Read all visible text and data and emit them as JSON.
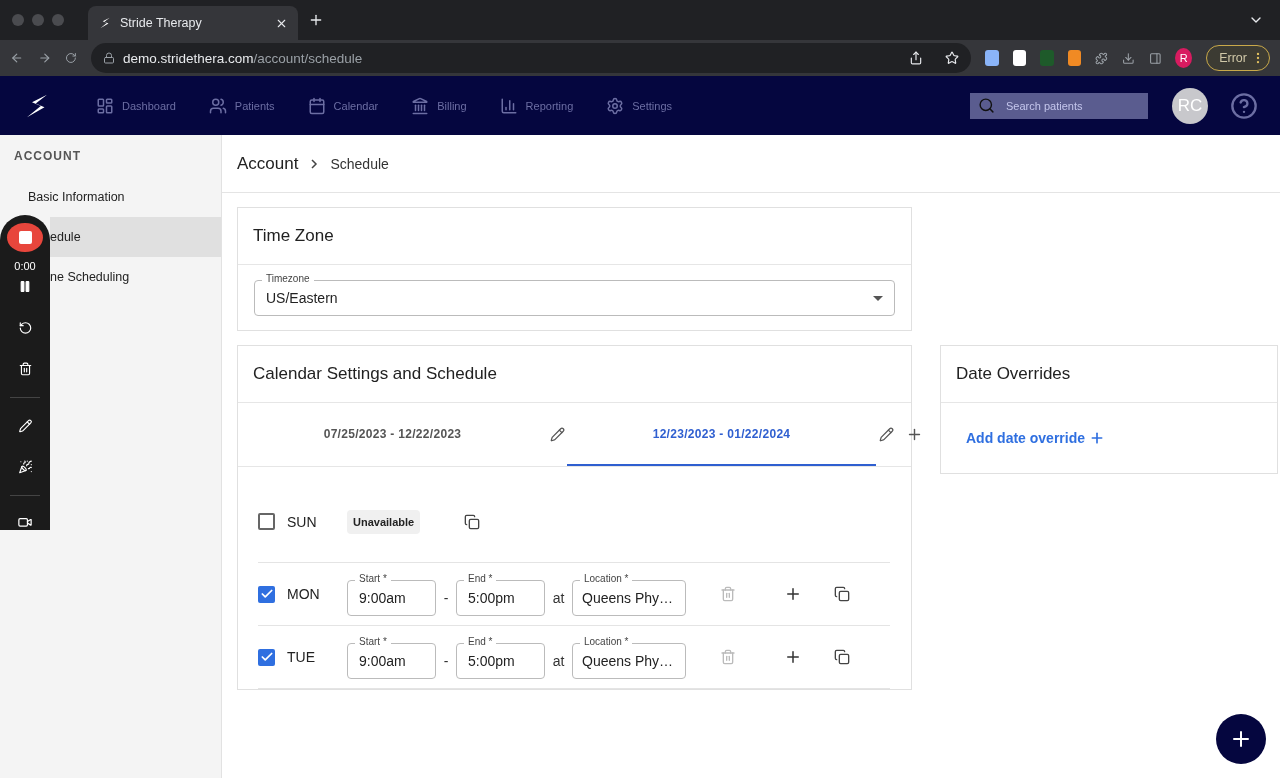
{
  "browser": {
    "tab_title": "Stride Therapy",
    "url_host": "demo.stridethera.com",
    "url_path": "/account/schedule",
    "profile_initial": "R",
    "error_label": "Error"
  },
  "nav": {
    "items": [
      {
        "label": "Dashboard"
      },
      {
        "label": "Patients"
      },
      {
        "label": "Calendar"
      },
      {
        "label": "Billing"
      },
      {
        "label": "Reporting"
      },
      {
        "label": "Settings"
      }
    ],
    "search_placeholder": "Search patients",
    "avatar": "RC"
  },
  "sidebar": {
    "heading": "ACCOUNT",
    "items": [
      {
        "label": "Basic Information",
        "selected": false
      },
      {
        "label": "edule",
        "selected": true
      },
      {
        "label": "ne Scheduling",
        "selected": false
      }
    ]
  },
  "recorder": {
    "time": "0:00"
  },
  "breadcrumb": [
    "Account",
    "Schedule"
  ],
  "timezone_card": {
    "title": "Time Zone",
    "field": {
      "label": "Timezone",
      "value": "US/Eastern"
    }
  },
  "schedule_card": {
    "title": "Calendar Settings and Schedule",
    "periods": [
      {
        "label": "07/25/2023 - 12/22/2023",
        "selected": false
      },
      {
        "label": "12/23/2023 - 01/22/2024",
        "selected": true
      }
    ],
    "days": [
      {
        "day": "SUN",
        "checked": false,
        "kind": "unavailable",
        "badge": "Unavailable"
      },
      {
        "day": "MON",
        "checked": true,
        "kind": "hours",
        "start_label": "Start *",
        "start": "9:00am",
        "separator": "-",
        "end_label": "End *",
        "end": "5:00pm",
        "at": "at",
        "location_label": "Location *",
        "location": "Queens Phy…"
      },
      {
        "day": "TUE",
        "checked": true,
        "kind": "hours",
        "start_label": "Start *",
        "start": "9:00am",
        "separator": "-",
        "end_label": "End *",
        "end": "5:00pm",
        "at": "at",
        "location_label": "Location *",
        "location": "Queens Phy…"
      }
    ]
  },
  "date_overrides": {
    "title": "Date Overrides",
    "link": "Add date override"
  }
}
